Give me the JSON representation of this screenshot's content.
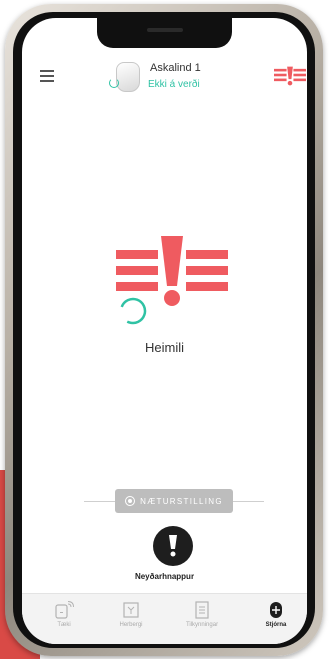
{
  "header": {
    "home_name": "Askalind 1",
    "status": "Ekki á verði"
  },
  "main": {
    "status_label": "Heimili"
  },
  "night_mode": {
    "label": "NÆTURSTILLING"
  },
  "panic": {
    "label": "Neyðarhnappur"
  },
  "tabs": [
    {
      "label": "Tæki",
      "icon": "devices-icon",
      "active": false
    },
    {
      "label": "Herbergi",
      "icon": "rooms-icon",
      "active": false
    },
    {
      "label": "Tilkynningar",
      "icon": "notifications-icon",
      "active": false
    },
    {
      "label": "Stjórna",
      "icon": "control-icon",
      "active": true
    }
  ],
  "colors": {
    "alarm_red": "#ef5b60",
    "accent_teal": "#2fc2a4",
    "dark": "#1e1e1e"
  }
}
